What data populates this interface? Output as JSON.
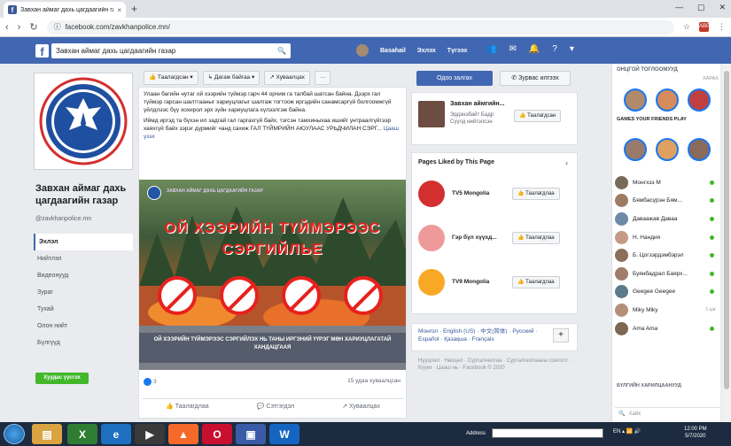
{
  "browser": {
    "tab_title": "Завхан аймаг дахь цагдаагийн га",
    "tab_close": "×",
    "new_tab": "+",
    "url": "facebook.com/zavkhanpolice.mn/",
    "nav_back": "‹",
    "nav_forward": "›",
    "nav_reload": "↻",
    "lock": "ⓘ",
    "star": "☆",
    "abp_label": "ABP",
    "menu": "⋮",
    "minimize": "—",
    "maximize": "▢",
    "close": "✕"
  },
  "fb": {
    "logo": "f",
    "search_value": "Завхан аймаг дахь цагдаагийн газар",
    "search_icon": "🔍",
    "nav_user": "Basahail",
    "nav_home": "Эхлэх",
    "nav_create": "Түгээх",
    "icon_friends": "👥",
    "icon_messenger": "✉",
    "icon_notifications": "🔔",
    "icon_help": "?",
    "icon_menu": "▾"
  },
  "page": {
    "name": "Завхан аймаг дахь цагдаагийн газар",
    "handle": "@zavkhanpolice.mn",
    "nav": [
      {
        "label": "Эхлэл",
        "active": true
      },
      {
        "label": "Нийтлэл",
        "active": false
      },
      {
        "label": "Видеонууд",
        "active": false
      },
      {
        "label": "Зураг",
        "active": false
      },
      {
        "label": "Тухай",
        "active": false
      },
      {
        "label": "Олон нийт",
        "active": false
      },
      {
        "label": "Бүлгүүд",
        "active": false
      }
    ],
    "create_button": "Хуудас үүсгэх",
    "actions": {
      "liked": "👍 Таалагдсан ▾",
      "following": "↳ Дагаж байгаа ▾",
      "share": "↗ Хуваалцах",
      "more": "···"
    },
    "send_message": "Одоо залгах",
    "edit_message": "✆ Зурвас илгээх"
  },
  "post": {
    "text1": "Улаан багийн нутаг ой хээрийн түймэр гарч 44 орчим га талбай шатсан байна. Дээрх гал түймэр гарсан шалтгааныг хариуцлагыг шалгаж тогтоож иргэдийн санамсаргүй болгоомжгүй үйлдлээс бүү хохирол эрх зүйн хариуцлага хүлээлгэж байна.",
    "text2": "Иймд иргэд та бүхэн ил задгай гал гаргахгүй байх, тэгсэн тамхиныхаа ишийг унтраалгүйгээр хаяхгүй байх зэрэг дүрмийг чанд сахиж ГАЛ ТҮЙМРИЙН АЮУЛААС УРЬДЧИЛАН СЭРГ...",
    "see_more": "Цааш үзэх",
    "poster_org": "ЗАВХАН АЙМАГ ДАХЬ ЦАГДААГИЙН ГАЗАР",
    "poster_title1": "ОЙ ХЭЭРИЙН ТҮЙМЭРЭЭС",
    "poster_title2": "СЭРГИЙЛЬЕ",
    "poster_caption": "ОЙ ХЭЭРИЙН ТҮЙМЭРЭЭС СЭРГИЙЛЭХ НЬ ТАНЫ ИРГЭНИЙ ҮҮРЭГ МӨН ХАРИУЦЛАГАТАЙ ХАНДАЦГААЯ",
    "reactions": "3",
    "shares": "15 удаа хуваалцсан",
    "btn_like": "👍 Таалагдлаа",
    "btn_comment": "💬 Сэтгэгдэл",
    "btn_share": "↗ Хуваалцах"
  },
  "sidebar": {
    "related_name": "Завхан аймгийн...",
    "related_sub": "Эрдэнэбайт Бадр\nСүүлд нийтэлсэн",
    "related_like": "👍 Таалагдсан",
    "pages_liked_header": "Pages Liked by This Page",
    "pages_liked_chev": "›",
    "pages_liked": [
      {
        "name": "TV5 Mongolia",
        "button": "👍 Таалагдлаа",
        "color": "#d32f2f"
      },
      {
        "name": "Гэр бүл хүүхд...",
        "button": "👍 Таалагдлаа",
        "color": "#ef9a9a"
      },
      {
        "name": "TV9 Mongolia",
        "button": "👍 Таалагдлаа",
        "color": "#f9a825"
      }
    ],
    "languages": "Монгол · English (US) · 中文(简体) · Русский · Español · Қазақша · Français",
    "lang_plus": "+",
    "footer": "Нууцлал · Нөхцөл · Сурталчилгаа · Сурталчилгааны сонголт · Күүки · Цааш нь · Facebook © 2020"
  },
  "chat": {
    "stories_header": "ОНЦГОЙ ТОГЛООМУУД",
    "stories_more": "ХАРАХ",
    "stories_caption": "GAMES YOUR FRIENDS PLAY",
    "contacts": [
      {
        "name": "Монгхзэ М",
        "status": "online",
        "color": "#7a6a5a"
      },
      {
        "name": "Бямбасүрэн Бям...",
        "status": "online",
        "color": "#9d7c63"
      },
      {
        "name": "Даваажав Даваа",
        "status": "online",
        "color": "#6e8aa6"
      },
      {
        "name": "Н. Нандия",
        "status": "online",
        "color": "#c49b85"
      },
      {
        "name": "Б. Цогзэрдэмбэрэл",
        "status": "online",
        "color": "#8c6f5d"
      },
      {
        "name": "Буянбадрал Баярх...",
        "status": "online",
        "color": "#a07c6a"
      },
      {
        "name": "Geegee Geegee",
        "status": "online",
        "color": "#5d7a8c"
      },
      {
        "name": "Miky Miky",
        "status": "time",
        "time": "1 цаг",
        "color": "#b58f7a"
      },
      {
        "name": "Ama Ama",
        "status": "online",
        "color": "#7d6652"
      }
    ],
    "groups_header": "БҮЛГИЙН ХАРИЛЦААНУУД",
    "search_placeholder": "Хайх"
  },
  "taskbar": {
    "address_label": "Address",
    "tray": "EN ▴ 📶 🔊",
    "time": "12:00 PM",
    "date": "5/7/2020"
  }
}
